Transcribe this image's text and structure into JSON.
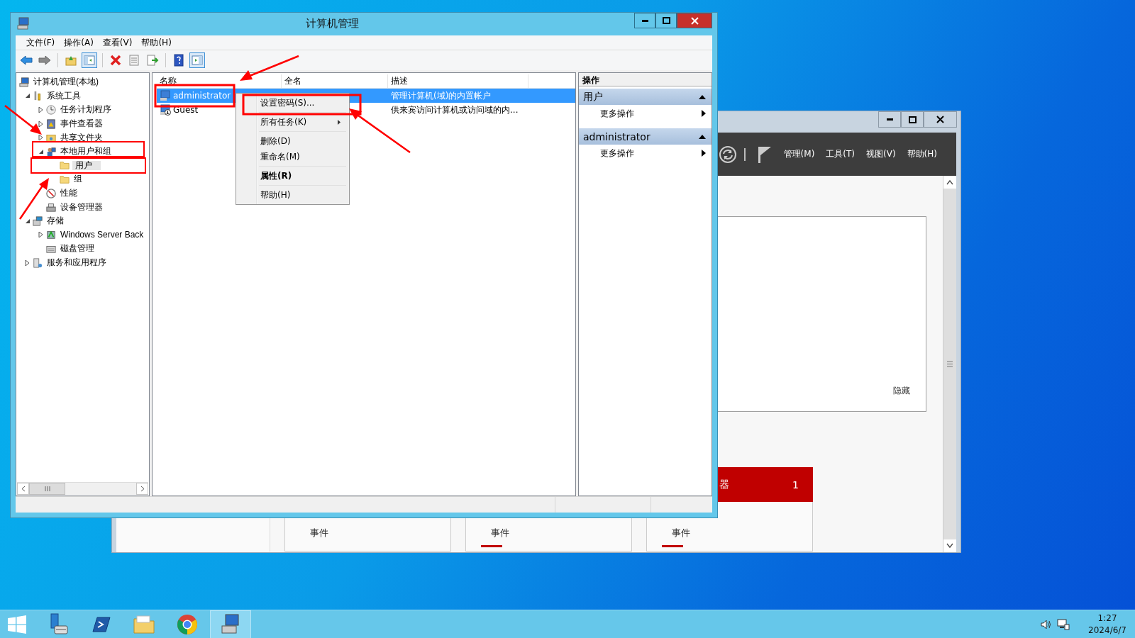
{
  "background_window": {
    "menus": [
      "管理(M)",
      "工具(T)",
      "视图(V)",
      "帮助(H)"
    ],
    "panel": {
      "link": "隐藏"
    },
    "tiles": [
      {
        "label": "事件",
        "alert": false
      },
      {
        "label": "事件",
        "alert": true
      },
      {
        "label": "事件",
        "alert": true,
        "header": {
          "title": "器",
          "count": "1"
        }
      }
    ]
  },
  "window": {
    "title": "计算机管理",
    "menu": [
      "文件(F)",
      "操作(A)",
      "查看(V)",
      "帮助(H)"
    ],
    "toolbar": [
      {
        "kind": "back"
      },
      {
        "kind": "forward"
      },
      {
        "kind": "separator"
      },
      {
        "kind": "up"
      },
      {
        "kind": "tree-toggle",
        "pressed": true
      },
      {
        "kind": "separator"
      },
      {
        "kind": "delete"
      },
      {
        "kind": "properties"
      },
      {
        "kind": "export"
      },
      {
        "kind": "separator"
      },
      {
        "kind": "help"
      },
      {
        "kind": "actions-toggle",
        "pressed": true
      }
    ],
    "tree": [
      {
        "label": "计算机管理(本地)",
        "kind": "computer",
        "selected": false,
        "children": [
          {
            "label": "系统工具",
            "kind": "tools",
            "expanded": true,
            "selected": false,
            "children": [
              {
                "label": "任务计划程序",
                "kind": "clock",
                "expanded": false,
                "selected": false
              },
              {
                "label": "事件查看器",
                "kind": "log",
                "expanded": false,
                "selected": false
              },
              {
                "label": "共享文件夹",
                "kind": "shared",
                "expanded": false,
                "selected": false
              },
              {
                "label": "本地用户和组",
                "kind": "users",
                "expanded": true,
                "selected": false,
                "children": [
                  {
                    "label": "用户",
                    "kind": "folder",
                    "selected": true
                  },
                  {
                    "label": "组",
                    "kind": "folder",
                    "selected": false
                  }
                ]
              },
              {
                "label": "性能",
                "kind": "gauge",
                "selected": false
              },
              {
                "label": "设备管理器",
                "kind": "device",
                "selected": false
              }
            ]
          },
          {
            "label": "存储",
            "kind": "storage",
            "expanded": true,
            "selected": false,
            "children": [
              {
                "label": "Windows Server Back",
                "kind": "backup",
                "expanded": false,
                "selected": false
              },
              {
                "label": "磁盘管理",
                "kind": "disk",
                "selected": false
              }
            ]
          },
          {
            "label": "服务和应用程序",
            "kind": "services",
            "expanded": false,
            "selected": false
          }
        ]
      }
    ],
    "list": {
      "columns": [
        "名称",
        "全名",
        "描述"
      ],
      "rows": [
        {
          "name": "administrator",
          "description": "管理计算机(域)的内置帐户",
          "disabled": false,
          "selected": true
        },
        {
          "name": "Guest",
          "description": "供来宾访问计算机或访问域的内...",
          "disabled": true,
          "selected": false
        }
      ]
    },
    "context_menu": [
      {
        "kind": "item",
        "label": "设置密码(S)..."
      },
      {
        "kind": "separator"
      },
      {
        "kind": "item",
        "label": "所有任务(K)",
        "submenu": true
      },
      {
        "kind": "separator"
      },
      {
        "kind": "item",
        "label": "删除(D)"
      },
      {
        "kind": "item",
        "label": "重命名(M)"
      },
      {
        "kind": "separator"
      },
      {
        "kind": "item",
        "label": "属性(R)",
        "bold": true
      },
      {
        "kind": "separator"
      },
      {
        "kind": "item",
        "label": "帮助(H)"
      }
    ],
    "actions": {
      "title": "操作",
      "sections": [
        {
          "title": "用户",
          "expanded": true,
          "items": [
            {
              "label": "更多操作",
              "submenu": true
            }
          ]
        },
        {
          "title": "administrator",
          "expanded": true,
          "items": [
            {
              "label": "更多操作",
              "submenu": true
            }
          ]
        }
      ]
    }
  },
  "taskbar": {
    "apps": [
      {
        "kind": "server-manager",
        "active": false
      },
      {
        "kind": "powershell",
        "active": false
      },
      {
        "kind": "explorer",
        "active": false
      },
      {
        "kind": "chrome",
        "active": false
      },
      {
        "kind": "computer-management",
        "active": true
      }
    ],
    "clock": {
      "time": "1:27",
      "date": "2024/6/7"
    }
  }
}
